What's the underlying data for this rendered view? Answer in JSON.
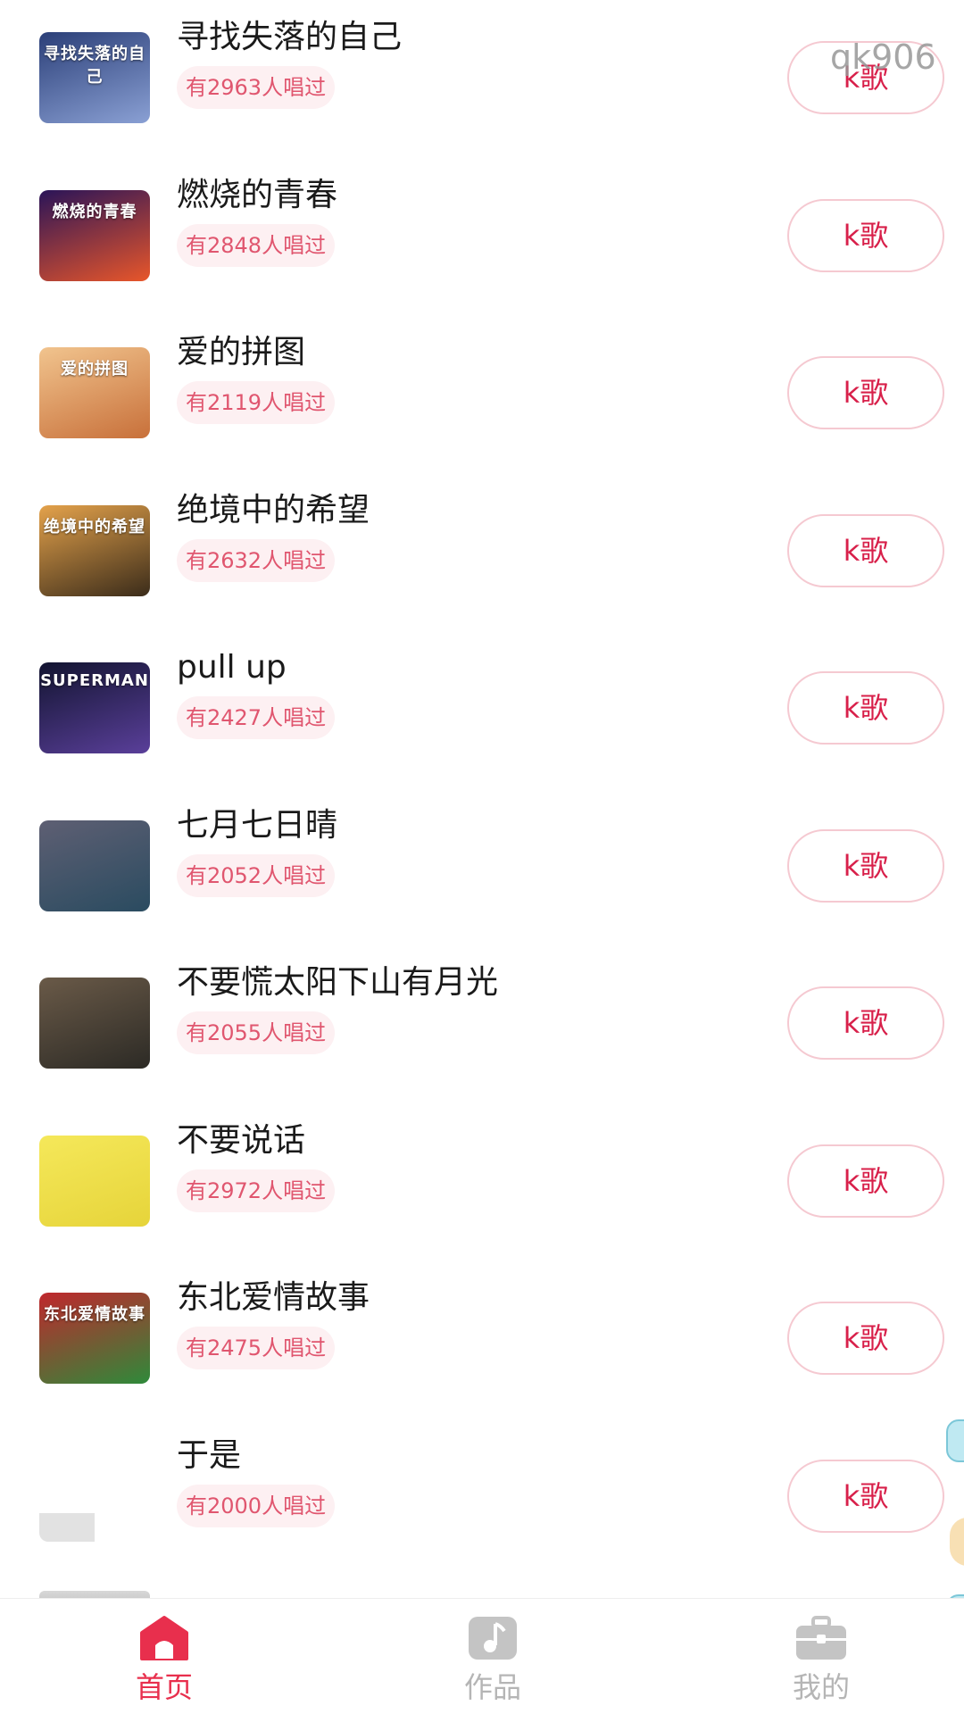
{
  "watermark": "qk906",
  "songs": [
    {
      "title": "寻找失落的自己",
      "count": "有2963人唱过",
      "button": "k歌",
      "cover_text": "寻找失落的自己",
      "cover_colors": [
        "#2b3f78",
        "#8aa0d4"
      ]
    },
    {
      "title": "燃烧的青春",
      "count": "有2848人唱过",
      "button": "k歌",
      "cover_text": "燃烧的青春",
      "cover_colors": [
        "#2a1458",
        "#e8562a"
      ]
    },
    {
      "title": "爱的拼图",
      "count": "有2119人唱过",
      "button": "k歌",
      "cover_text": "爱的拼图",
      "cover_colors": [
        "#f1c48e",
        "#c8703a"
      ]
    },
    {
      "title": "绝境中的希望",
      "count": "有2632人唱过",
      "button": "k歌",
      "cover_text": "绝境中的希望",
      "cover_colors": [
        "#e4a24b",
        "#3b2c1a"
      ]
    },
    {
      "title": "pull up",
      "count": "有2427人唱过",
      "button": "k歌",
      "cover_text": "SUPERMAN",
      "cover_colors": [
        "#121430",
        "#5a3f9a"
      ]
    },
    {
      "title": "七月七日晴",
      "count": "有2052人唱过",
      "button": "k歌",
      "cover_text": "",
      "cover_colors": [
        "#5e5f73",
        "#2a4b60"
      ]
    },
    {
      "title": "不要慌太阳下山有月光",
      "count": "有2055人唱过",
      "button": "k歌",
      "cover_text": "",
      "cover_colors": [
        "#6a5a48",
        "#2c2a25"
      ]
    },
    {
      "title": "不要说话",
      "count": "有2972人唱过",
      "button": "k歌",
      "cover_text": "",
      "cover_colors": [
        "#f5e85a",
        "#e6d43a"
      ]
    },
    {
      "title": "东北爱情故事",
      "count": "有2475人唱过",
      "button": "k歌",
      "cover_text": "东北爱情故事",
      "cover_colors": [
        "#c0272d",
        "#2e8a3a"
      ]
    },
    {
      "title": "于是",
      "count": "有2000人唱过",
      "button": "k歌",
      "cover_text": "",
      "cover_colors": [
        "#ffffff",
        "#e9e9e9"
      ]
    }
  ],
  "tabs": [
    {
      "label": "首页",
      "icon": "home-icon",
      "active": true
    },
    {
      "label": "作品",
      "icon": "music-note-icon",
      "active": false
    },
    {
      "label": "我的",
      "icon": "briefcase-icon",
      "active": false
    }
  ],
  "colors": {
    "accent": "#e82f4d",
    "count_text": "#e0566f",
    "count_bg": "#fdf0f2",
    "button_border": "#f5c9d1",
    "inactive_tab": "#b5b5b5"
  }
}
